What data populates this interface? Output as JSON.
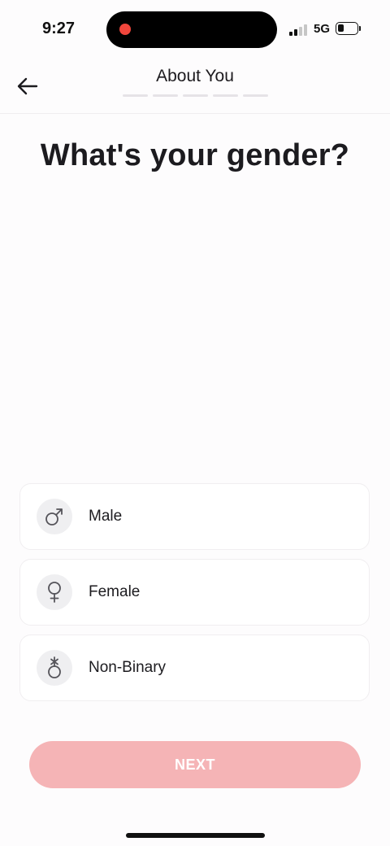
{
  "status_bar": {
    "time": "9:27",
    "network": "5G",
    "battery_level": 0.35
  },
  "header": {
    "title": "About You",
    "progress_steps": 5,
    "progress_completed": 0,
    "back_icon": "arrow-left-icon"
  },
  "question": "What's your gender?",
  "options": [
    {
      "label": "Male",
      "icon": "male-symbol-icon"
    },
    {
      "label": "Female",
      "icon": "female-symbol-icon"
    },
    {
      "label": "Non-Binary",
      "icon": "non-binary-symbol-icon"
    }
  ],
  "next_button": {
    "label": "NEXT",
    "background": "#f5b4b6",
    "enabled": false
  }
}
